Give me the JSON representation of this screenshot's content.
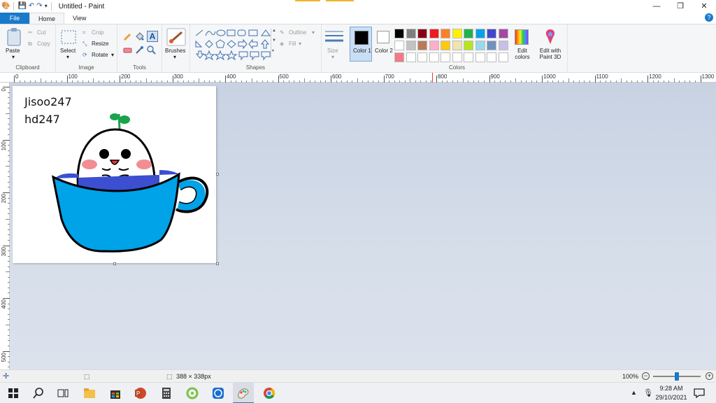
{
  "window": {
    "title": "Untitled - Paint"
  },
  "tabs": {
    "file": "File",
    "home": "Home",
    "view": "View"
  },
  "ribbon": {
    "clipboard": {
      "label": "Clipboard",
      "paste": "Paste",
      "cut": "Cut",
      "copy": "Copy"
    },
    "image": {
      "label": "Image",
      "select": "Select",
      "crop": "Crop",
      "resize": "Resize",
      "rotate": "Rotate"
    },
    "tools": {
      "label": "Tools",
      "brushes": "Brushes"
    },
    "shapes": {
      "label": "Shapes",
      "outline": "Outline",
      "fill": "Fill"
    },
    "size": {
      "label": "Size"
    },
    "colors": {
      "label": "Colors",
      "color1": "Color 1",
      "color2": "Color 2",
      "edit_colors": "Edit colors",
      "paint3d": "Edit with Paint 3D",
      "palette_row1": [
        "#000000",
        "#7f7f7f",
        "#880015",
        "#ed1c24",
        "#ff7f27",
        "#fff200",
        "#22b14c",
        "#00a2e8",
        "#3f48cc",
        "#a349a4"
      ],
      "palette_row2": [
        "#ffffff",
        "#c3c3c3",
        "#b97a57",
        "#ffaec9",
        "#ffc90e",
        "#efe4b0",
        "#b5e61d",
        "#99d9ea",
        "#7092be",
        "#c8bfe7"
      ],
      "palette_row3": [
        "#f37a82",
        "#ffffff",
        "#ffffff",
        "#ffffff",
        "#ffffff",
        "#ffffff",
        "#ffffff",
        "#ffffff",
        "#ffffff",
        "#ffffff"
      ]
    }
  },
  "ruler": {
    "h_ticks": [
      "0",
      "100",
      "200",
      "300",
      "400",
      "500",
      "600",
      "700",
      "800",
      "900",
      "1000",
      "1100",
      "1200",
      "1300"
    ],
    "v_ticks": [
      "0",
      "100",
      "200",
      "300",
      "400",
      "500"
    ]
  },
  "canvas": {
    "line1": "Jisoo247",
    "line2": "hd247"
  },
  "status": {
    "size": "388 × 338px",
    "zoom": "100%"
  },
  "tray": {
    "time": "9:28 AM",
    "date": "29/10/2021"
  }
}
